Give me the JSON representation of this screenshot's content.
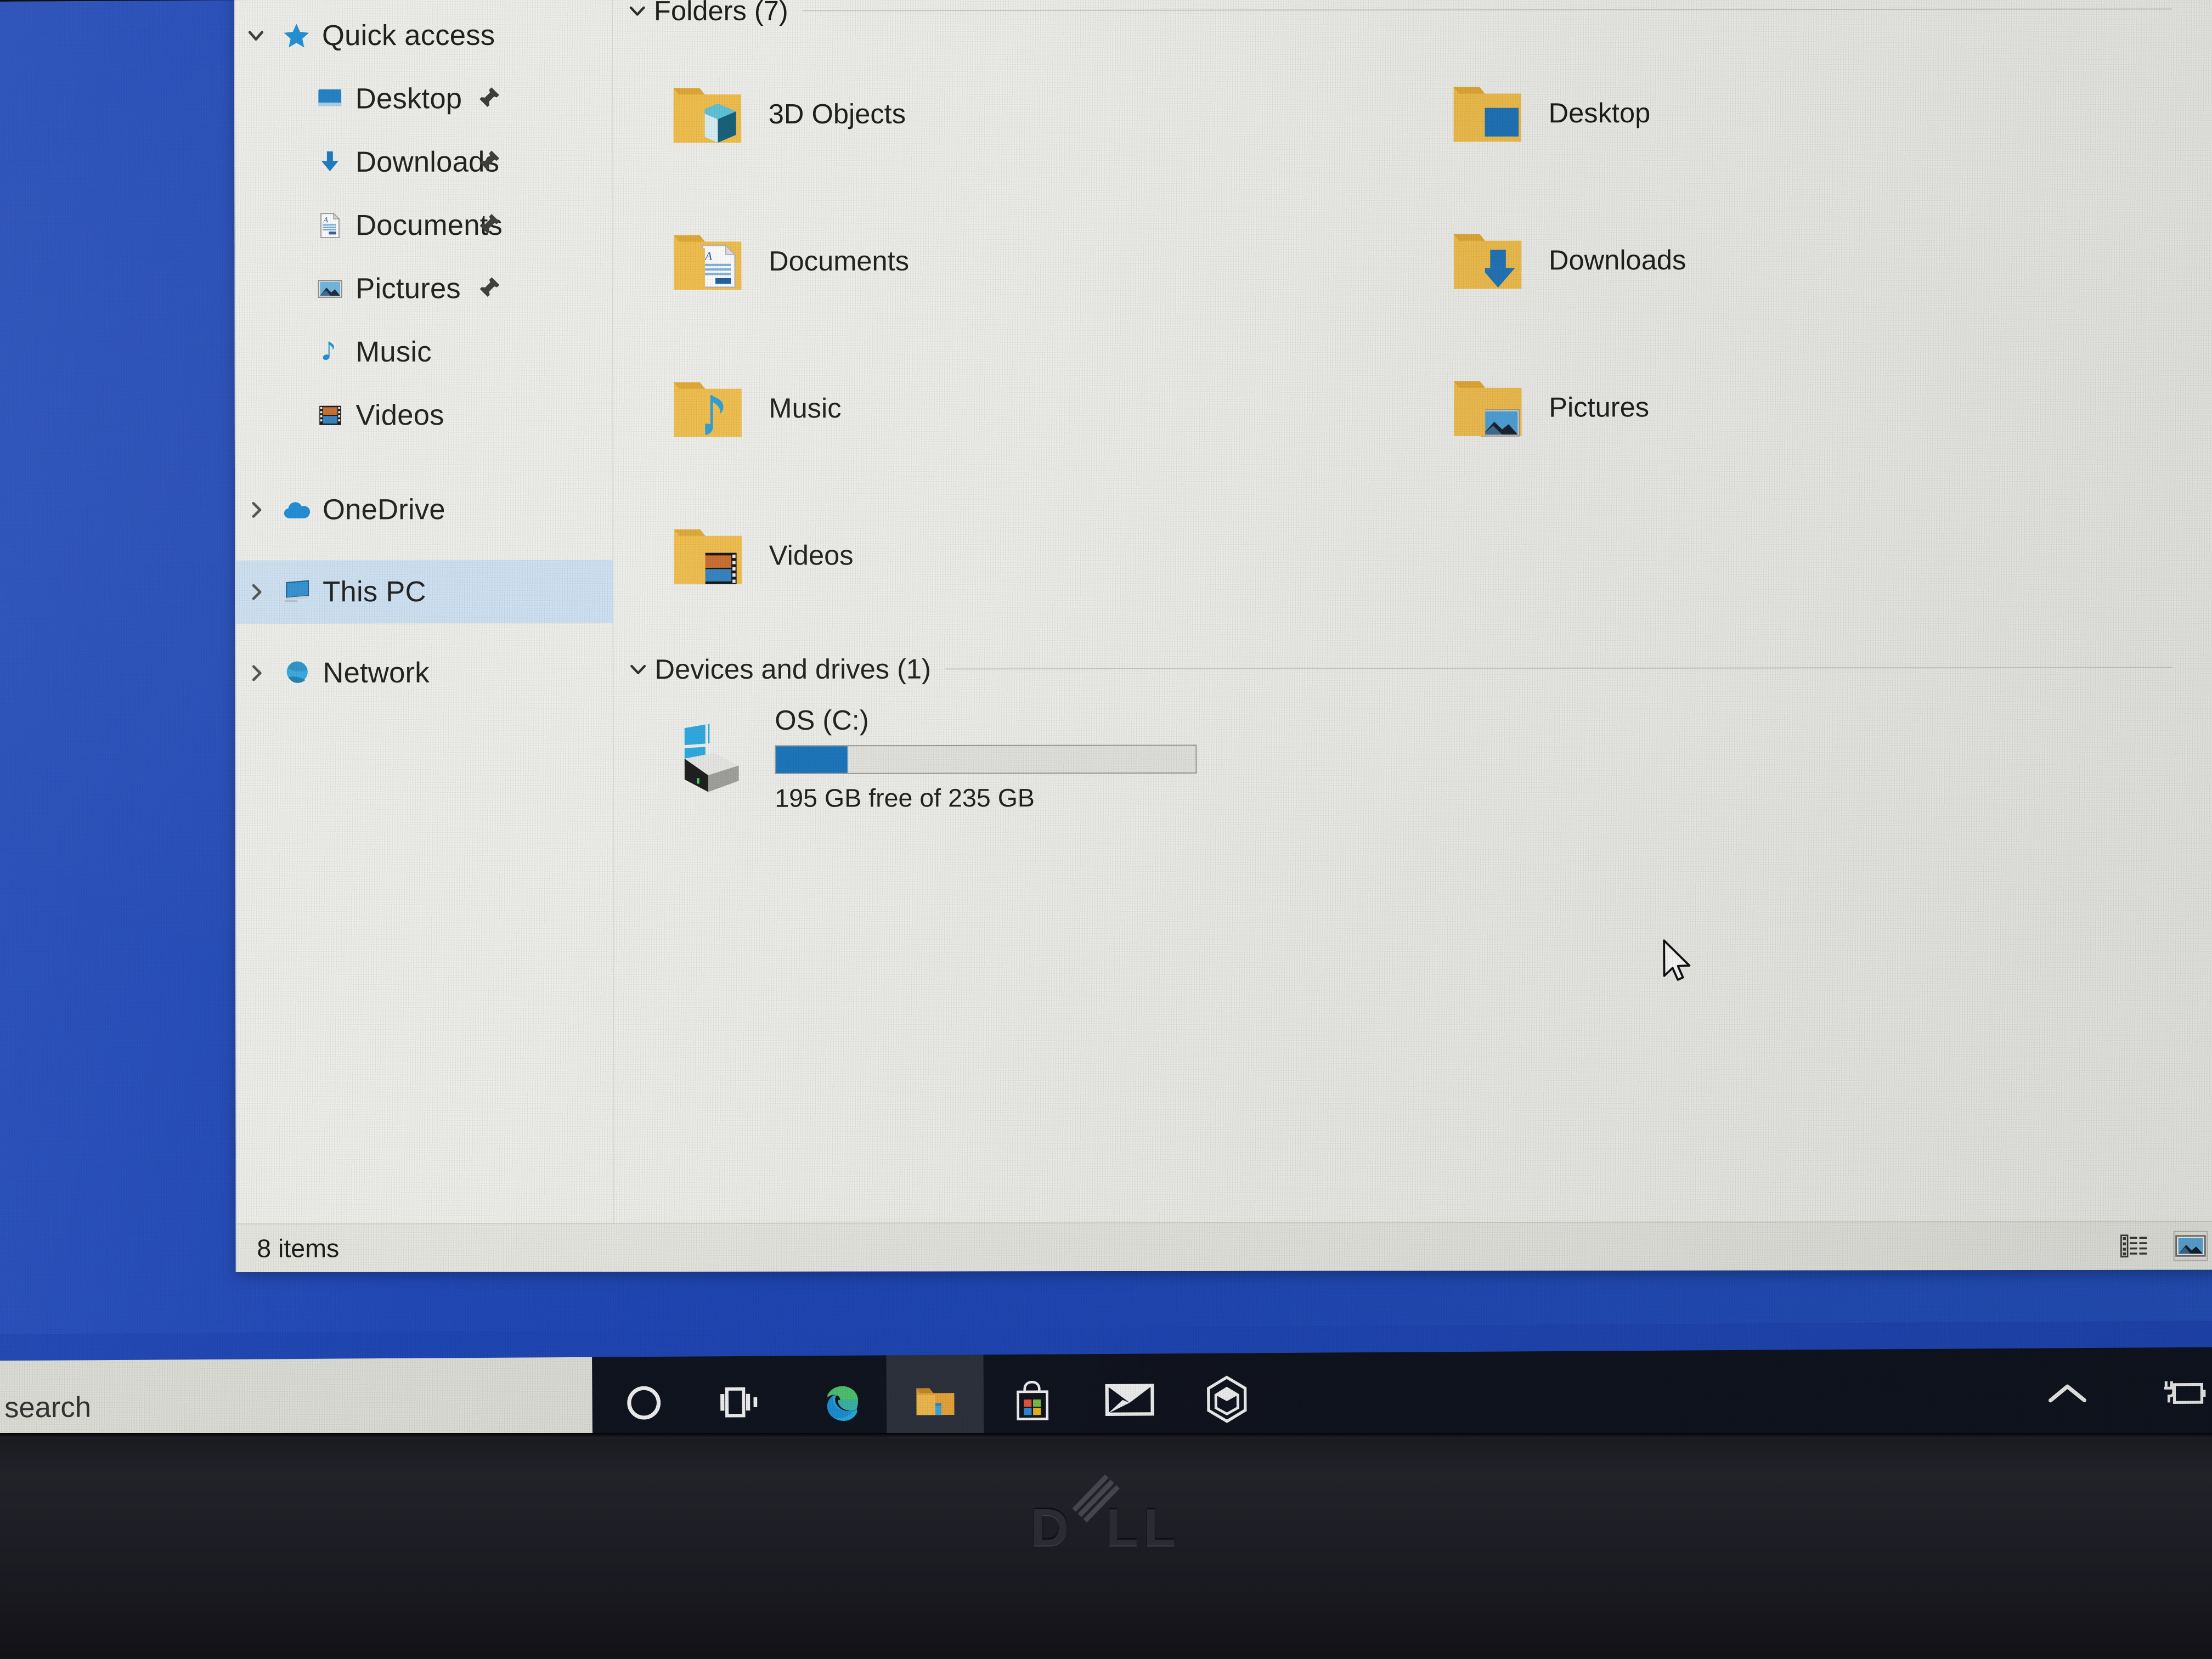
{
  "window": {
    "app": "File Explorer",
    "location": "This PC"
  },
  "nav_pane": {
    "items": [
      {
        "label": "Quick access",
        "icon": "star-icon",
        "chevron": "down",
        "indent": 0,
        "pinned": false,
        "selected": false
      },
      {
        "label": "Desktop",
        "icon": "desktop-icon",
        "chevron": "none",
        "indent": 1,
        "pinned": true,
        "selected": false
      },
      {
        "label": "Downloads",
        "icon": "download-arrow-icon",
        "chevron": "none",
        "indent": 1,
        "pinned": true,
        "selected": false
      },
      {
        "label": "Documents",
        "icon": "document-icon",
        "chevron": "none",
        "indent": 1,
        "pinned": true,
        "selected": false
      },
      {
        "label": "Pictures",
        "icon": "picture-icon",
        "chevron": "none",
        "indent": 1,
        "pinned": true,
        "selected": false
      },
      {
        "label": "Music",
        "icon": "music-note-icon",
        "chevron": "none",
        "indent": 1,
        "pinned": false,
        "selected": false
      },
      {
        "label": "Videos",
        "icon": "film-strip-icon",
        "chevron": "none",
        "indent": 1,
        "pinned": false,
        "selected": false
      },
      {
        "label": "OneDrive",
        "icon": "cloud-icon",
        "chevron": "right",
        "indent": 0,
        "pinned": false,
        "selected": false
      },
      {
        "label": "This PC",
        "icon": "monitor-icon",
        "chevron": "right",
        "indent": 0,
        "pinned": false,
        "selected": true
      },
      {
        "label": "Network",
        "icon": "network-globe-icon",
        "chevron": "right",
        "indent": 0,
        "pinned": false,
        "selected": false
      }
    ]
  },
  "content": {
    "folders_group": {
      "title": "Folders (7)",
      "chevron": "down",
      "items": [
        {
          "label": "3D Objects",
          "icon": "folder-3d-objects-icon"
        },
        {
          "label": "Desktop",
          "icon": "folder-desktop-icon"
        },
        {
          "label": "Documents",
          "icon": "folder-documents-icon"
        },
        {
          "label": "Downloads",
          "icon": "folder-downloads-icon"
        },
        {
          "label": "Music",
          "icon": "folder-music-icon"
        },
        {
          "label": "Pictures",
          "icon": "folder-pictures-icon"
        },
        {
          "label": "Videos",
          "icon": "folder-videos-icon"
        }
      ]
    },
    "devices_group": {
      "title": "Devices and drives (1)",
      "chevron": "down",
      "drive": {
        "name": "OS (C:)",
        "icon": "windows-hard-drive-icon",
        "free_text": "195 GB free of 235 GB",
        "free_gb": 195,
        "total_gb": 235,
        "used_percent": 17,
        "bar_color": "#1673bb"
      }
    }
  },
  "status_bar": {
    "item_count": "8 items",
    "view_buttons": [
      {
        "name": "details-view",
        "label": "Details view",
        "active": false
      },
      {
        "name": "large-icons-view",
        "label": "Large icons view",
        "active": true
      }
    ]
  },
  "taskbar": {
    "search": {
      "placeholder": "Type here to search",
      "visible_text": "e to search"
    },
    "buttons": [
      {
        "name": "cortana",
        "label": "Cortana",
        "icon": "circle-icon",
        "active": false
      },
      {
        "name": "task-view",
        "label": "Task View",
        "icon": "task-view-icon",
        "active": false
      },
      {
        "name": "edge",
        "label": "Microsoft Edge",
        "icon": "edge-icon",
        "active": false
      },
      {
        "name": "file-explorer",
        "label": "File Explorer",
        "icon": "folder-icon",
        "active": true
      },
      {
        "name": "microsoft-store",
        "label": "Microsoft Store",
        "icon": "store-bag-icon",
        "active": false
      },
      {
        "name": "mail",
        "label": "Mail",
        "icon": "envelope-icon",
        "active": false
      },
      {
        "name": "3d-viewer",
        "label": "3D Viewer",
        "icon": "hexagon-cube-icon",
        "active": false
      }
    ],
    "tray": [
      {
        "name": "show-hidden-icons",
        "label": "Show hidden icons",
        "icon": "chevron-up-icon"
      },
      {
        "name": "battery-status",
        "label": "Battery charging",
        "icon": "battery-plug-icon"
      }
    ]
  },
  "device": {
    "brand": "DELL"
  },
  "colors": {
    "desktop_blue": "#1f46b4",
    "window_bg": "#eeeeea",
    "selection_blue": "#cde1f2",
    "accent_blue": "#1673bb",
    "taskbar_dark": "#10141f",
    "folder_yellow": "#f0bd4a"
  }
}
